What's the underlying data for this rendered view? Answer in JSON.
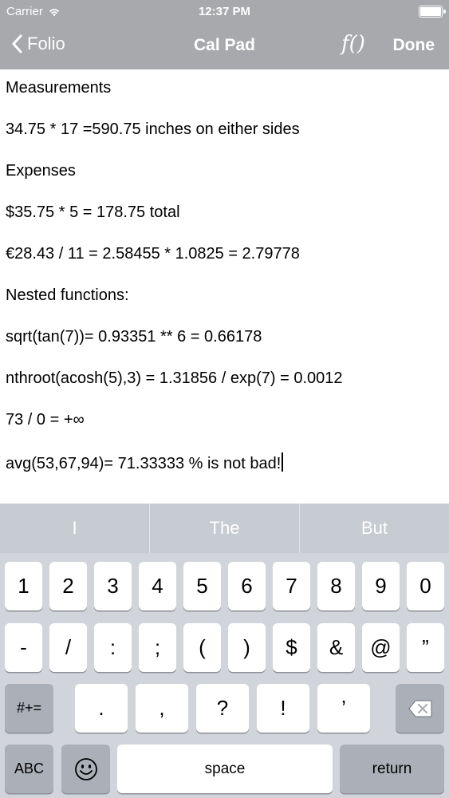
{
  "status_bar": {
    "carrier": "Carrier",
    "time": "12:37 PM"
  },
  "nav": {
    "back_label": "Folio",
    "title": "Cal Pad",
    "fx_label": "f()",
    "done_label": "Done"
  },
  "editor": {
    "lines": [
      "Measurements",
      "34.75 * 17 =590.75 inches on either sides",
      "Expenses",
      "$35.75 * 5 = 178.75 total",
      "€28.43 / 11 = 2.58455 * 1.0825 = 2.79778",
      "Nested functions:",
      "sqrt(tan(7))= 0.93351 ** 6 = 0.66178",
      "nthroot(acosh(5),3) = 1.31856 / exp(7) = 0.0012",
      "73 / 0 = +∞",
      "avg(53,67,94)= 71.33333 % is not bad!"
    ]
  },
  "keyboard": {
    "suggestions": [
      "I",
      "The",
      "But"
    ],
    "row1": [
      "1",
      "2",
      "3",
      "4",
      "5",
      "6",
      "7",
      "8",
      "9",
      "0"
    ],
    "row2": [
      "-",
      "/",
      ":",
      ";",
      "(",
      ")",
      "$",
      "&",
      "@",
      "”"
    ],
    "row3": [
      ".",
      ",",
      "?",
      "!",
      "’"
    ],
    "symbols_label": "#+=",
    "abc_label": "ABC",
    "space_label": "space",
    "return_label": "return",
    "emoji_icon": "smiley-icon",
    "delete_icon": "backspace-icon"
  }
}
